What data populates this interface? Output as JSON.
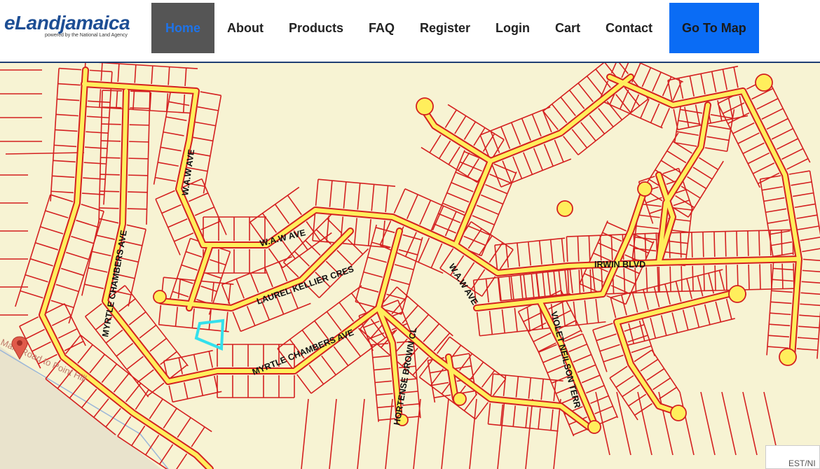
{
  "logo": {
    "main": "eLandjamaica",
    "sub": "powered by the National Land Agency"
  },
  "nav": {
    "home": "Home",
    "about": "About",
    "products": "Products",
    "faq": "FAQ",
    "register": "Register",
    "login": "Login",
    "cart": "Cart",
    "contact": "Contact",
    "go_to_map": "Go To Map"
  },
  "colors": {
    "parcel_line": "#d42020",
    "road": "#ffee5c",
    "background": "#f7f3d3",
    "highlight": "#33e0ec",
    "nav_accent": "#0a6cf5"
  },
  "map": {
    "street_labels": {
      "waw_ave_north": "W.A.W AVE",
      "waw_ave_mid": "W.A.W AVE",
      "waw_ave_south": "W.A.W AVE",
      "myrtle_chambers_ave_west": "MYRTLE CHAMBERS AVE",
      "myrtle_chambers_ave_south": "MYRTLE CHAMBERS AVE",
      "laurel_kellier_cres": "LAUREL KELLIER CRES",
      "irwin_blvd": "IRWIN BLVD",
      "violet_neilson_terr": "VIOLET NEILSON TERR",
      "hortense_brown_cl": "HORTENSE BROWN CL",
      "main_road": "Main Road to Point Hill"
    },
    "marker_icon": "location-pin-icon",
    "scale_text": "EST/NI"
  }
}
